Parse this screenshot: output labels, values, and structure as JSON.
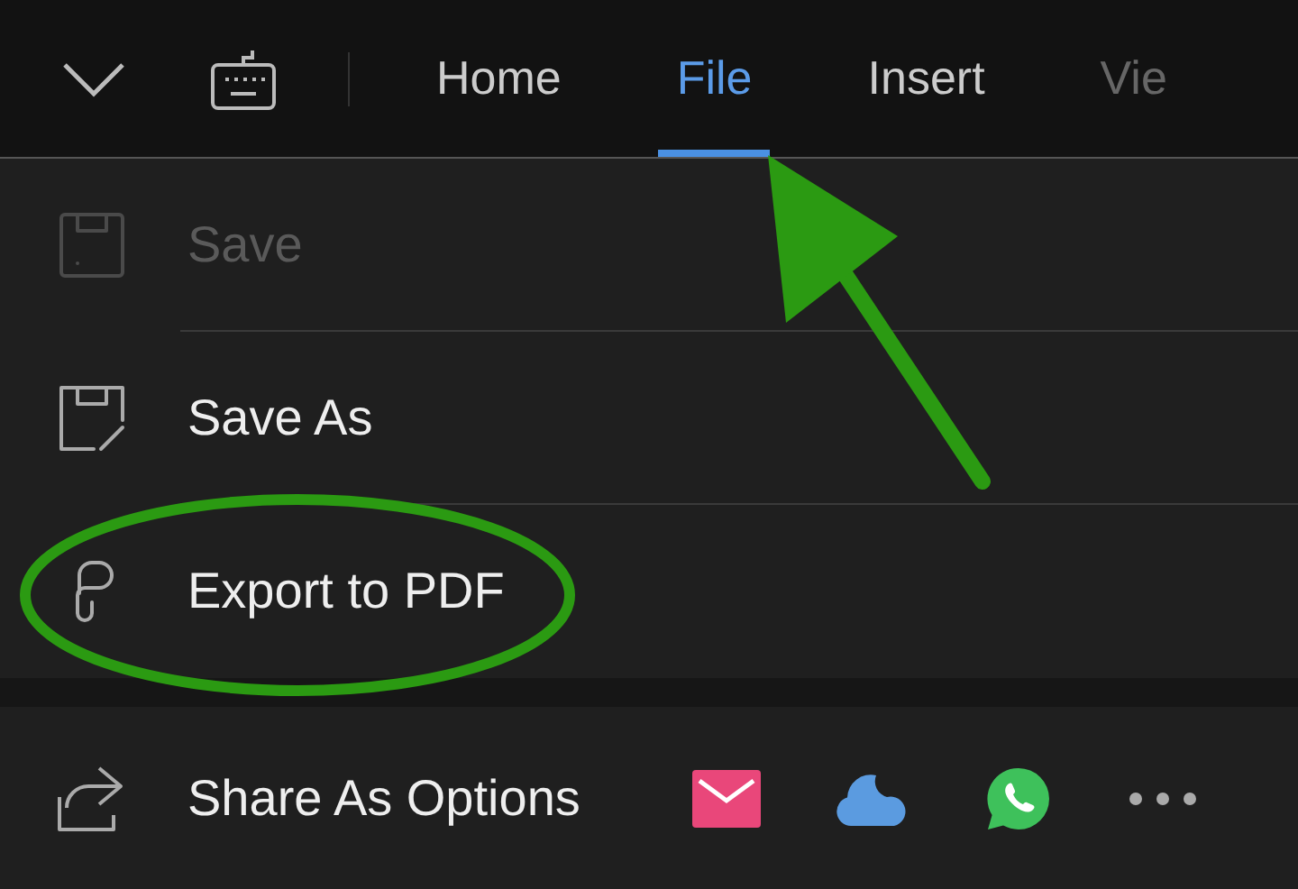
{
  "toolbar": {
    "tabs": [
      {
        "label": "Home",
        "selected": false,
        "faded": false
      },
      {
        "label": "File",
        "selected": true,
        "faded": false
      },
      {
        "label": "Insert",
        "selected": false,
        "faded": false
      },
      {
        "label": "Vie",
        "selected": false,
        "faded": true
      }
    ]
  },
  "menu": [
    {
      "kind": "save",
      "label": "Save",
      "disabled": true
    },
    {
      "kind": "save-as",
      "label": "Save As",
      "disabled": false
    },
    {
      "kind": "pdf",
      "label": "Export to PDF",
      "disabled": false
    }
  ],
  "share": {
    "label": "Share As Options",
    "targets": [
      {
        "kind": "mail"
      },
      {
        "kind": "cloud"
      },
      {
        "kind": "chat"
      },
      {
        "kind": "more"
      }
    ]
  }
}
